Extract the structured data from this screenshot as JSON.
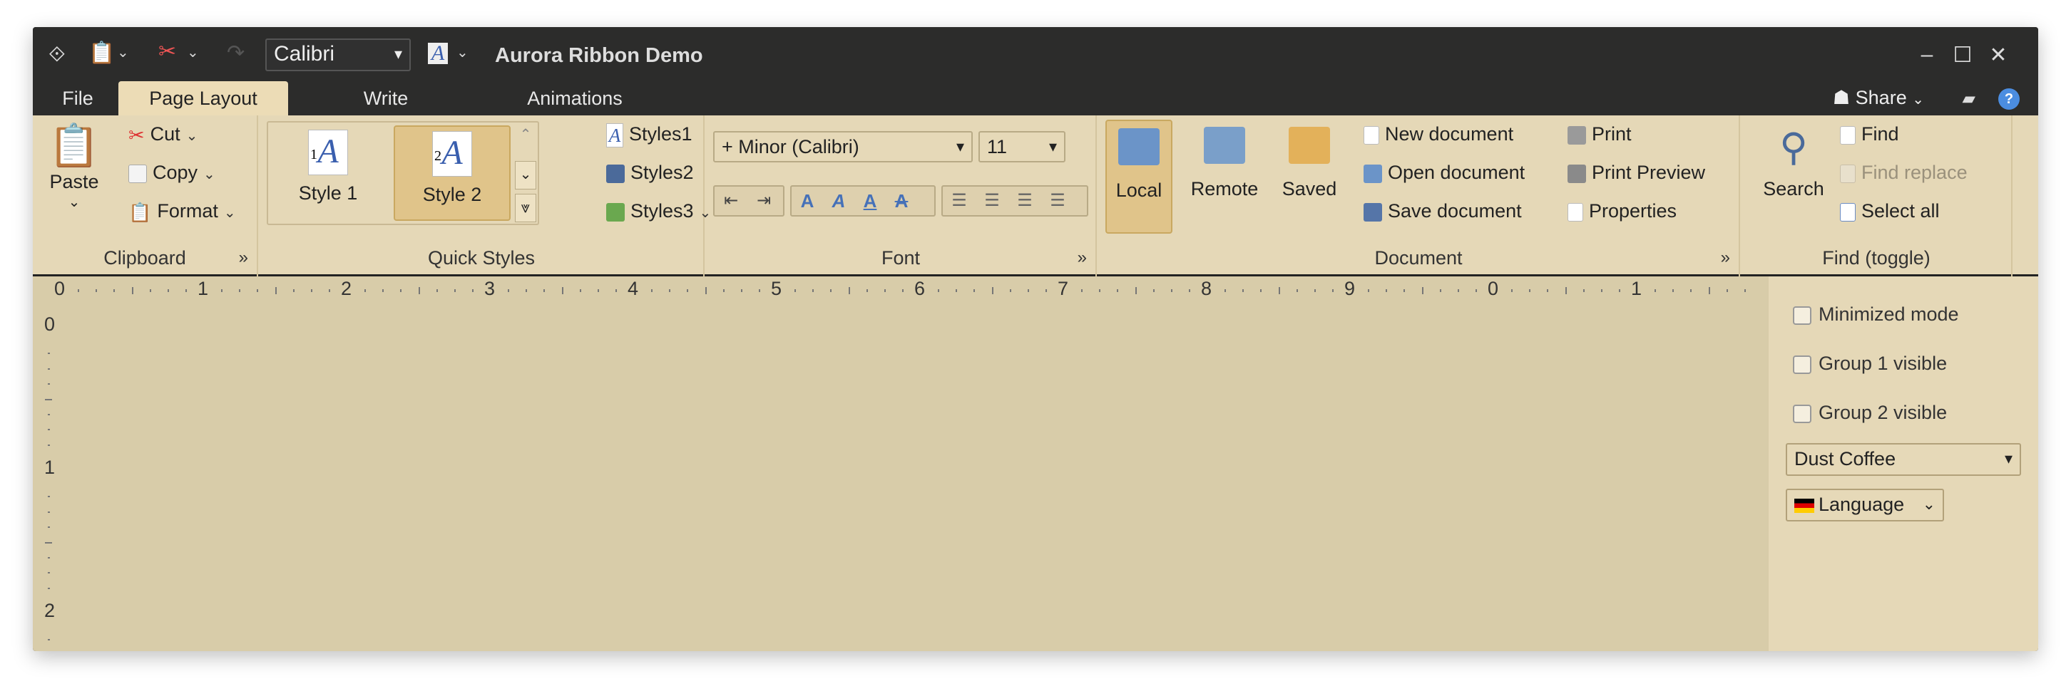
{
  "titlebar": {
    "font_value": "Calibri",
    "app_title": "Aurora Ribbon Demo",
    "minimize": "–",
    "maximize": "☐",
    "close": "✕"
  },
  "tabs": [
    "File",
    "Page Layout",
    "Write",
    "Animations"
  ],
  "share_label": "Share",
  "ribbon": {
    "clipboard": {
      "label": "Clipboard",
      "paste": "Paste",
      "cut": "Cut",
      "copy": "Copy",
      "format": "Format"
    },
    "quick_styles": {
      "label": "Quick Styles",
      "style1": "Style 1",
      "style2": "Style 2",
      "style1_num": "1",
      "style2_num": "2",
      "styles1": "Styles1",
      "styles2": "Styles2",
      "styles3": "Styles3"
    },
    "font": {
      "label": "Font",
      "family": "+ Minor (Calibri)",
      "size": "11"
    },
    "document": {
      "label": "Document",
      "local": "Local",
      "remote": "Remote",
      "saved": "Saved",
      "new_doc": "New document",
      "open_doc": "Open document",
      "save_doc": "Save document",
      "print": "Print",
      "print_preview": "Print Preview",
      "properties": "Properties"
    },
    "find": {
      "label": "Find (toggle)",
      "search": "Search",
      "find": "Find",
      "find_replace": "Find replace",
      "select_all": "Select all"
    }
  },
  "ruler": {
    "h_numbers": [
      "0",
      "1",
      "2",
      "3",
      "4",
      "5",
      "6",
      "7",
      "8",
      "9",
      "0",
      "1"
    ],
    "v_numbers": [
      "0",
      "1",
      "2"
    ]
  },
  "panel": {
    "minimized_mode": "Minimized mode",
    "group1_visible": "Group 1 visible",
    "group2_visible": "Group 2 visible",
    "skin": "Dust Coffee",
    "language": "Language"
  },
  "colors": {
    "ribbon_bg": "#e5d8b7",
    "content_bg": "#d8cca9",
    "titlebar_bg": "#2c2c2b",
    "selected_accent": "#e0c48a"
  }
}
